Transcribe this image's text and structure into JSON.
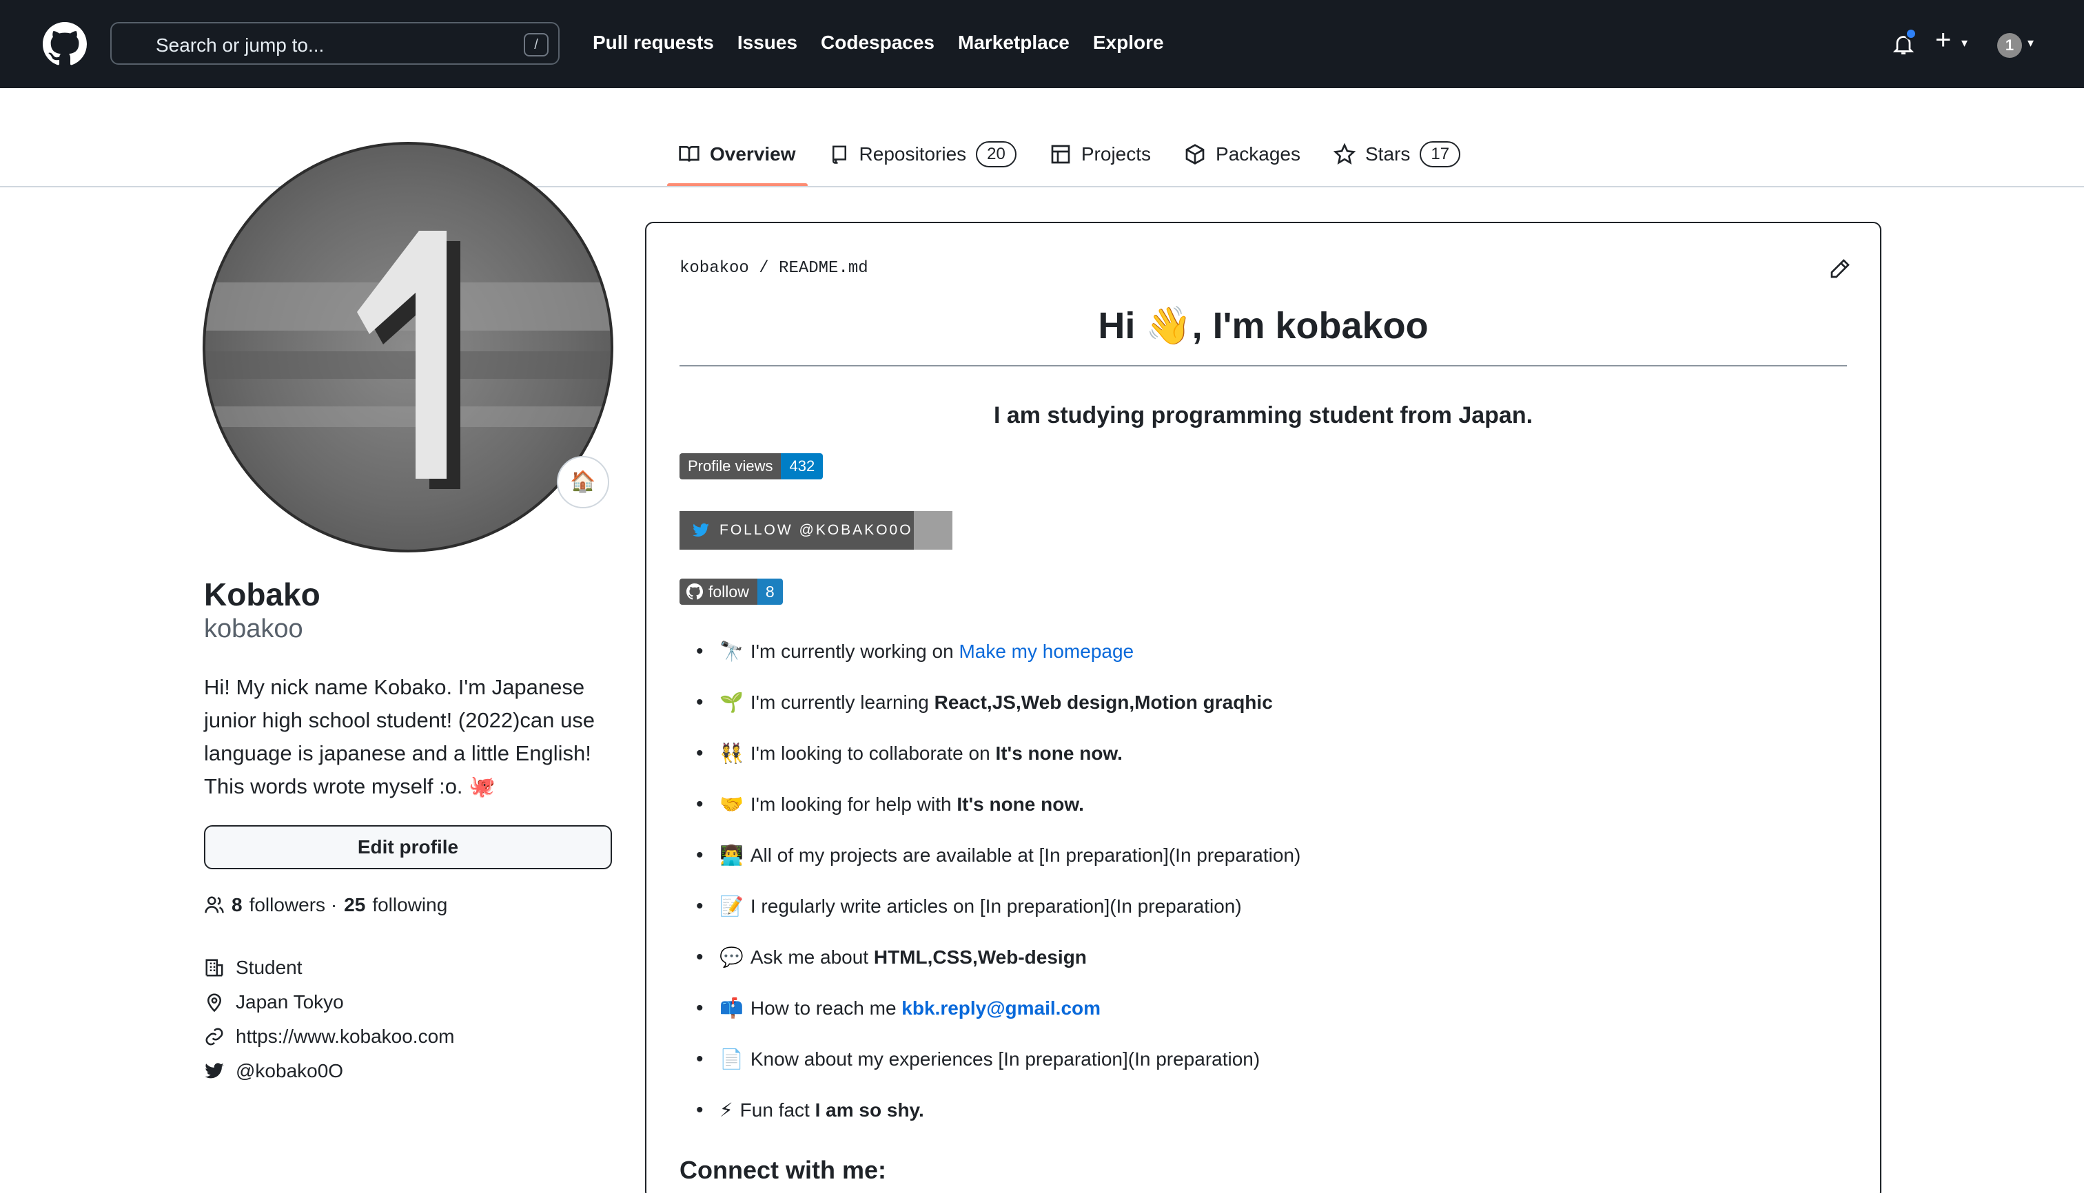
{
  "header": {
    "search_placeholder": "Search or jump to...",
    "search_shortcut": "/",
    "nav": [
      "Pull requests",
      "Issues",
      "Codespaces",
      "Marketplace",
      "Explore"
    ],
    "plus": "+",
    "avatar_char": "1"
  },
  "tabs": {
    "overview": "Overview",
    "repositories": "Repositories",
    "repositories_count": "20",
    "projects": "Projects",
    "packages": "Packages",
    "stars": "Stars",
    "stars_count": "17"
  },
  "profile": {
    "status_emoji": "🏠",
    "name": "Kobako",
    "login": "kobakoo",
    "bio": "Hi! My nick name Kobako. I'm Japanese junior high school student! (2022)can use language is japanese and a little English! This words wrote myself :o. 🐙",
    "edit_profile": "Edit profile",
    "followers_count": "8",
    "followers_label": "followers ·",
    "following_count": "25",
    "following_label": "following",
    "company": "Student",
    "location": "Japan Tokyo",
    "website": "https://www.kobakoo.com",
    "twitter": "@kobako0O"
  },
  "readme": {
    "crumb_user": "kobakoo",
    "crumb_sep": "/",
    "crumb_file": "README.md",
    "title": "Hi 👋, I'm kobakoo",
    "subtitle": "I am studying programming student from Japan.",
    "badge_views_label": "Profile views",
    "badge_views_value": "432",
    "badge_twitter_label": "FOLLOW @KOBAKO0O",
    "badge_follow_label": "follow",
    "badge_follow_value": "8",
    "items": [
      {
        "emoji": "🔭",
        "text": "I'm currently working on ",
        "strong": "",
        "link": "Make my homepage"
      },
      {
        "emoji": "🌱",
        "text": "I'm currently learning ",
        "strong": "React,JS,Web design,Motion graqhic",
        "link": ""
      },
      {
        "emoji": "👯",
        "text": "I'm looking to collaborate on ",
        "strong": "It's none now.",
        "link": ""
      },
      {
        "emoji": "🤝",
        "text": "I'm looking for help with ",
        "strong": "It's none now.",
        "link": ""
      },
      {
        "emoji": "👨‍💻",
        "text": "All of my projects are available at [In preparation](In preparation)",
        "strong": "",
        "link": ""
      },
      {
        "emoji": "📝",
        "text": "I regularly write articles on [In preparation](In preparation)",
        "strong": "",
        "link": ""
      },
      {
        "emoji": "💬",
        "text": "Ask me about ",
        "strong": "HTML,CSS,Web-design",
        "link": ""
      },
      {
        "emoji": "📫",
        "text": "How to reach me ",
        "strong": "",
        "link": "kbk.reply@gmail.com"
      },
      {
        "emoji": "📄",
        "text": "Know about my experiences [In preparation](In preparation)",
        "strong": "",
        "link": ""
      },
      {
        "emoji": "⚡",
        "text": "Fun fact ",
        "strong": "I am so shy.",
        "link": ""
      }
    ],
    "connect": "Connect with me:"
  },
  "colors": {
    "header_bg": "#161b22",
    "accent": "#fd8c73",
    "link": "#0969da",
    "badge_blue": "#007ec6"
  }
}
